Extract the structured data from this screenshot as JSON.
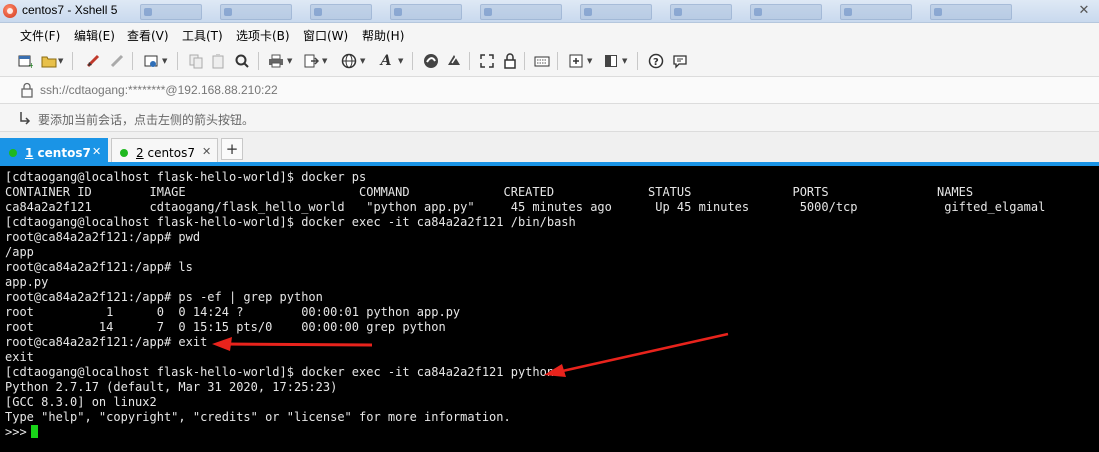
{
  "window": {
    "title": "centos7 - Xshell 5"
  },
  "menu": {
    "items": [
      "文件(F)",
      "编辑(E)",
      "查看(V)",
      "工具(T)",
      "选项卡(B)",
      "窗口(W)",
      "帮助(H)"
    ]
  },
  "toolbar": {
    "icons": [
      "new-session-icon",
      "open-folder-icon",
      "reconnect-icon",
      "disconnect-icon",
      "properties-icon",
      "copy-icon",
      "paste-icon",
      "find-icon",
      "print-icon",
      "transfer-icon",
      "globe-icon",
      "font-icon",
      "xftp-icon",
      "xshell-icon",
      "fullscreen-icon",
      "lock-icon",
      "keyboard-icon",
      "add-icon",
      "layout-icon",
      "help-icon",
      "chat-icon"
    ]
  },
  "address": {
    "text": "ssh://cdtaogang:********@192.168.88.210:22"
  },
  "hint": {
    "text": "要添加当前会话，点击左侧的箭头按钮。"
  },
  "tabs": [
    {
      "number": "1",
      "name": "centos7",
      "active": true
    },
    {
      "number": "2",
      "name": "centos7",
      "active": false
    }
  ],
  "colors": {
    "accent": "#1a94e6",
    "terminal_bg": "#000000",
    "terminal_fg": "#e6e6e6",
    "cursor": "#19d419",
    "arrow": "#e8231c",
    "status_connected": "#1fb81f"
  },
  "terminal": {
    "lines": [
      "[cdtaogang@localhost flask-hello-world]$ docker ps",
      "CONTAINER ID        IMAGE                        COMMAND             CREATED             STATUS              PORTS               NAMES",
      "ca84a2a2f121        cdtaogang/flask_hello_world   \"python app.py\"     45 minutes ago      Up 45 minutes       5000/tcp            gifted_elgamal",
      "[cdtaogang@localhost flask-hello-world]$ docker exec -it ca84a2a2f121 /bin/bash",
      "root@ca84a2a2f121:/app# pwd",
      "/app",
      "root@ca84a2a2f121:/app# ls",
      "app.py",
      "root@ca84a2a2f121:/app# ps -ef | grep python",
      "root          1      0  0 14:24 ?        00:00:01 python app.py",
      "root         14      7  0 15:15 pts/0    00:00:00 grep python",
      "root@ca84a2a2f121:/app# exit",
      "exit",
      "[cdtaogang@localhost flask-hello-world]$ docker exec -it ca84a2a2f121 python",
      "Python 2.7.17 (default, Mar 31 2020, 17:25:23)",
      "[GCC 8.3.0] on linux2",
      "Type \"help\", \"copyright\", \"credits\" or \"license\" for more information.",
      ">>>"
    ]
  }
}
